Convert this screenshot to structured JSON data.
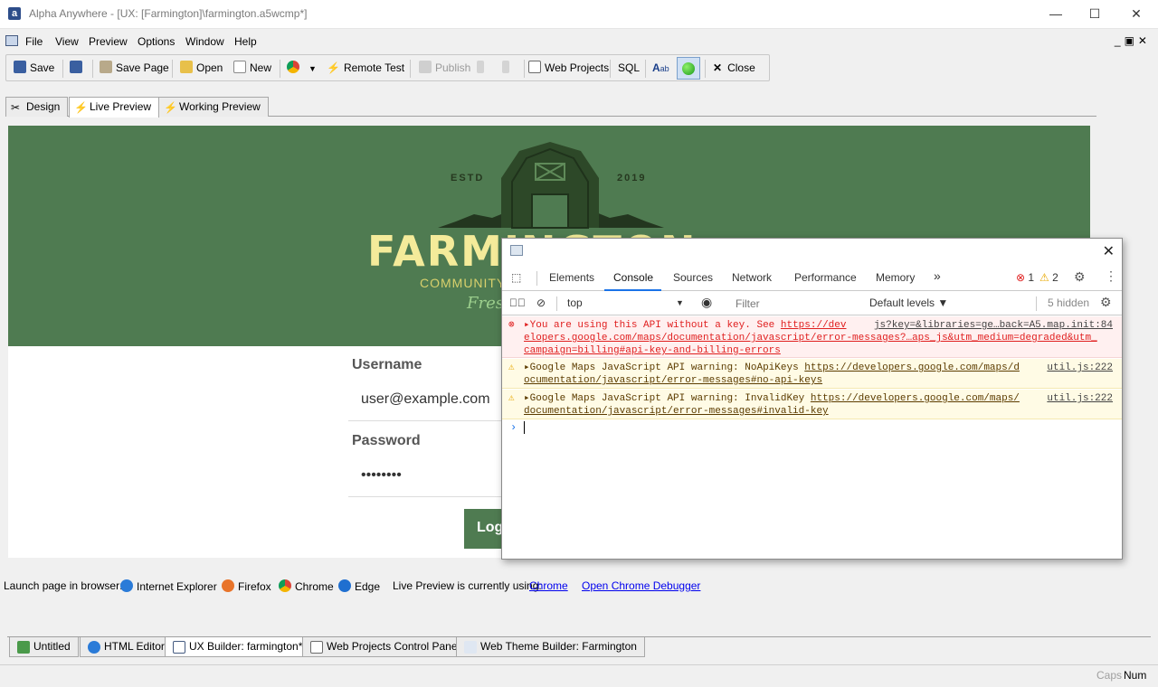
{
  "window": {
    "title": "Alpha Anywhere - [UX: [Farmington]\\farmington.a5wcmp*]",
    "minimize": "—",
    "maximize": "☐",
    "close": "✕"
  },
  "menu": {
    "items": [
      "File",
      "View",
      "Preview",
      "Options",
      "Window",
      "Help"
    ],
    "mdi": "_▣✕"
  },
  "toolbar": {
    "save": "Save",
    "save_page": "Save Page",
    "open": "Open",
    "new": "New",
    "remote_test": "Remote Test",
    "publish": "Publish",
    "web_projects": "Web Projects",
    "sql": "SQL",
    "close": "Close"
  },
  "design_tabs": [
    "Design",
    "Live Preview",
    "Working Preview"
  ],
  "page": {
    "estd": "ESTD",
    "year": "2019",
    "brand": "FARMINGTON",
    "subtitle": "COMMUNITY",
    "script": "Fresh",
    "username_label": "Username",
    "username_value": "user@example.com",
    "password_label": "Password",
    "password_value": "••••••••",
    "login_button": "Login"
  },
  "launch": {
    "label": "Launch page in browser:",
    "browsers": [
      "Internet Explorer",
      "Firefox",
      "Chrome",
      "Edge"
    ],
    "using_label": "Live Preview is currently using:",
    "using_value": "Chrome",
    "debugger": "Open Chrome Debugger"
  },
  "doc_tabs": [
    "Untitled",
    "HTML Editor",
    "UX Builder: farmington*",
    "Web Projects Control Panel",
    "Web Theme Builder: Farmington"
  ],
  "status": {
    "caps": "Caps",
    "num": "Num"
  },
  "devtools": {
    "tabs": [
      "Elements",
      "Console",
      "Sources",
      "Network",
      "Performance",
      "Memory",
      "»"
    ],
    "error_count": "1",
    "warning_count": "2",
    "context": "top",
    "filter_placeholder": "Filter",
    "levels": "Default levels ▼",
    "hidden": "5 hidden",
    "messages": [
      {
        "level": "error",
        "line1_text": "▸You are using this API without a key. See ",
        "line1_link": "https://dev",
        "source": "js?key=&libraries=ge…back=A5.map.init:84",
        "line2": "elopers.google.com/maps/documentation/javascript/error-messages?…aps_js&utm_medium=degraded&utm_",
        "line3": "campaign=billing#api-key-and-billing-errors"
      },
      {
        "level": "warning",
        "line1_text": "▸Google Maps JavaScript API warning: NoApiKeys ",
        "line1_link": "https://developers.google.com/maps/d",
        "source": "util.js:222",
        "line2": "ocumentation/javascript/error-messages#no-api-keys"
      },
      {
        "level": "warning",
        "line1_text": "▸Google Maps JavaScript API warning: InvalidKey ",
        "line1_link": "https://developers.google.com/maps/",
        "source": "util.js:222",
        "line2": "documentation/javascript/error-messages#invalid-key"
      }
    ],
    "prompt": "›"
  }
}
